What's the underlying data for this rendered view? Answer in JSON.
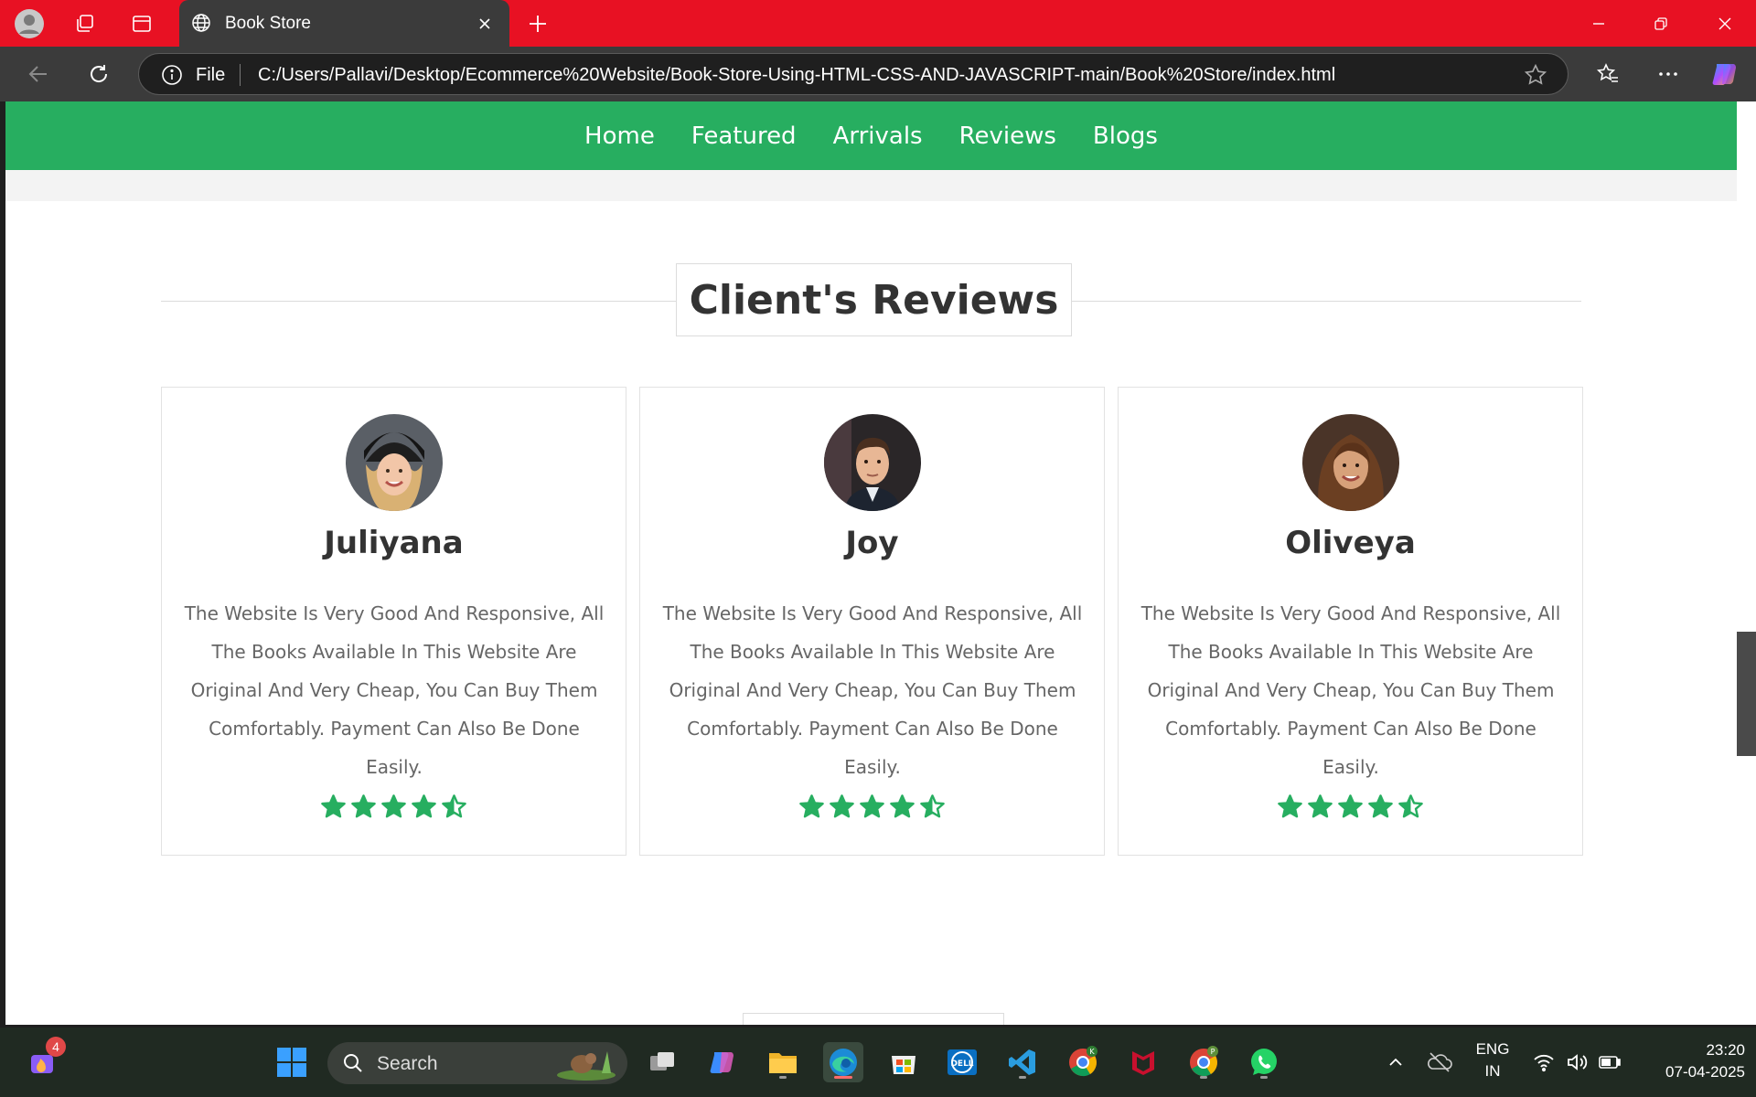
{
  "browser": {
    "tab_title": "Book Store",
    "address_label": "File",
    "url": "C:/Users/Pallavi/Desktop/Ecommerce%20Website/Book-Store-Using-HTML-CSS-AND-JAVASCRIPT-main/Book%20Store/index.html",
    "accent_color": "#e81123"
  },
  "page": {
    "nav": [
      "Home",
      "Featured",
      "Arrivals",
      "Reviews",
      "Blogs"
    ],
    "nav_color": "#27ae60",
    "heading": "Client's Reviews",
    "reviews": [
      {
        "name": "Juliyana",
        "text": "The Website Is Very Good And Responsive, All The Books Available In This Website Are Original And Very Cheap, You Can Buy Them Comfortably. Payment Can Also Be Done Easily.",
        "rating": 4.5
      },
      {
        "name": "Joy",
        "text": "The Website Is Very Good And Responsive, All The Books Available In This Website Are Original And Very Cheap, You Can Buy Them Comfortably. Payment Can Also Be Done Easily.",
        "rating": 4.5
      },
      {
        "name": "Oliveya",
        "text": "The Website Is Very Good And Responsive, All The Books Available In This Website Are Original And Very Cheap, You Can Buy Them Comfortably. Payment Can Also Be Done Easily.",
        "rating": 4.5
      }
    ]
  },
  "taskbar": {
    "search_placeholder": "Search",
    "notification_count": "4",
    "language_line1": "ENG",
    "language_line2": "IN",
    "time": "23:20",
    "date": "07-04-2025"
  }
}
